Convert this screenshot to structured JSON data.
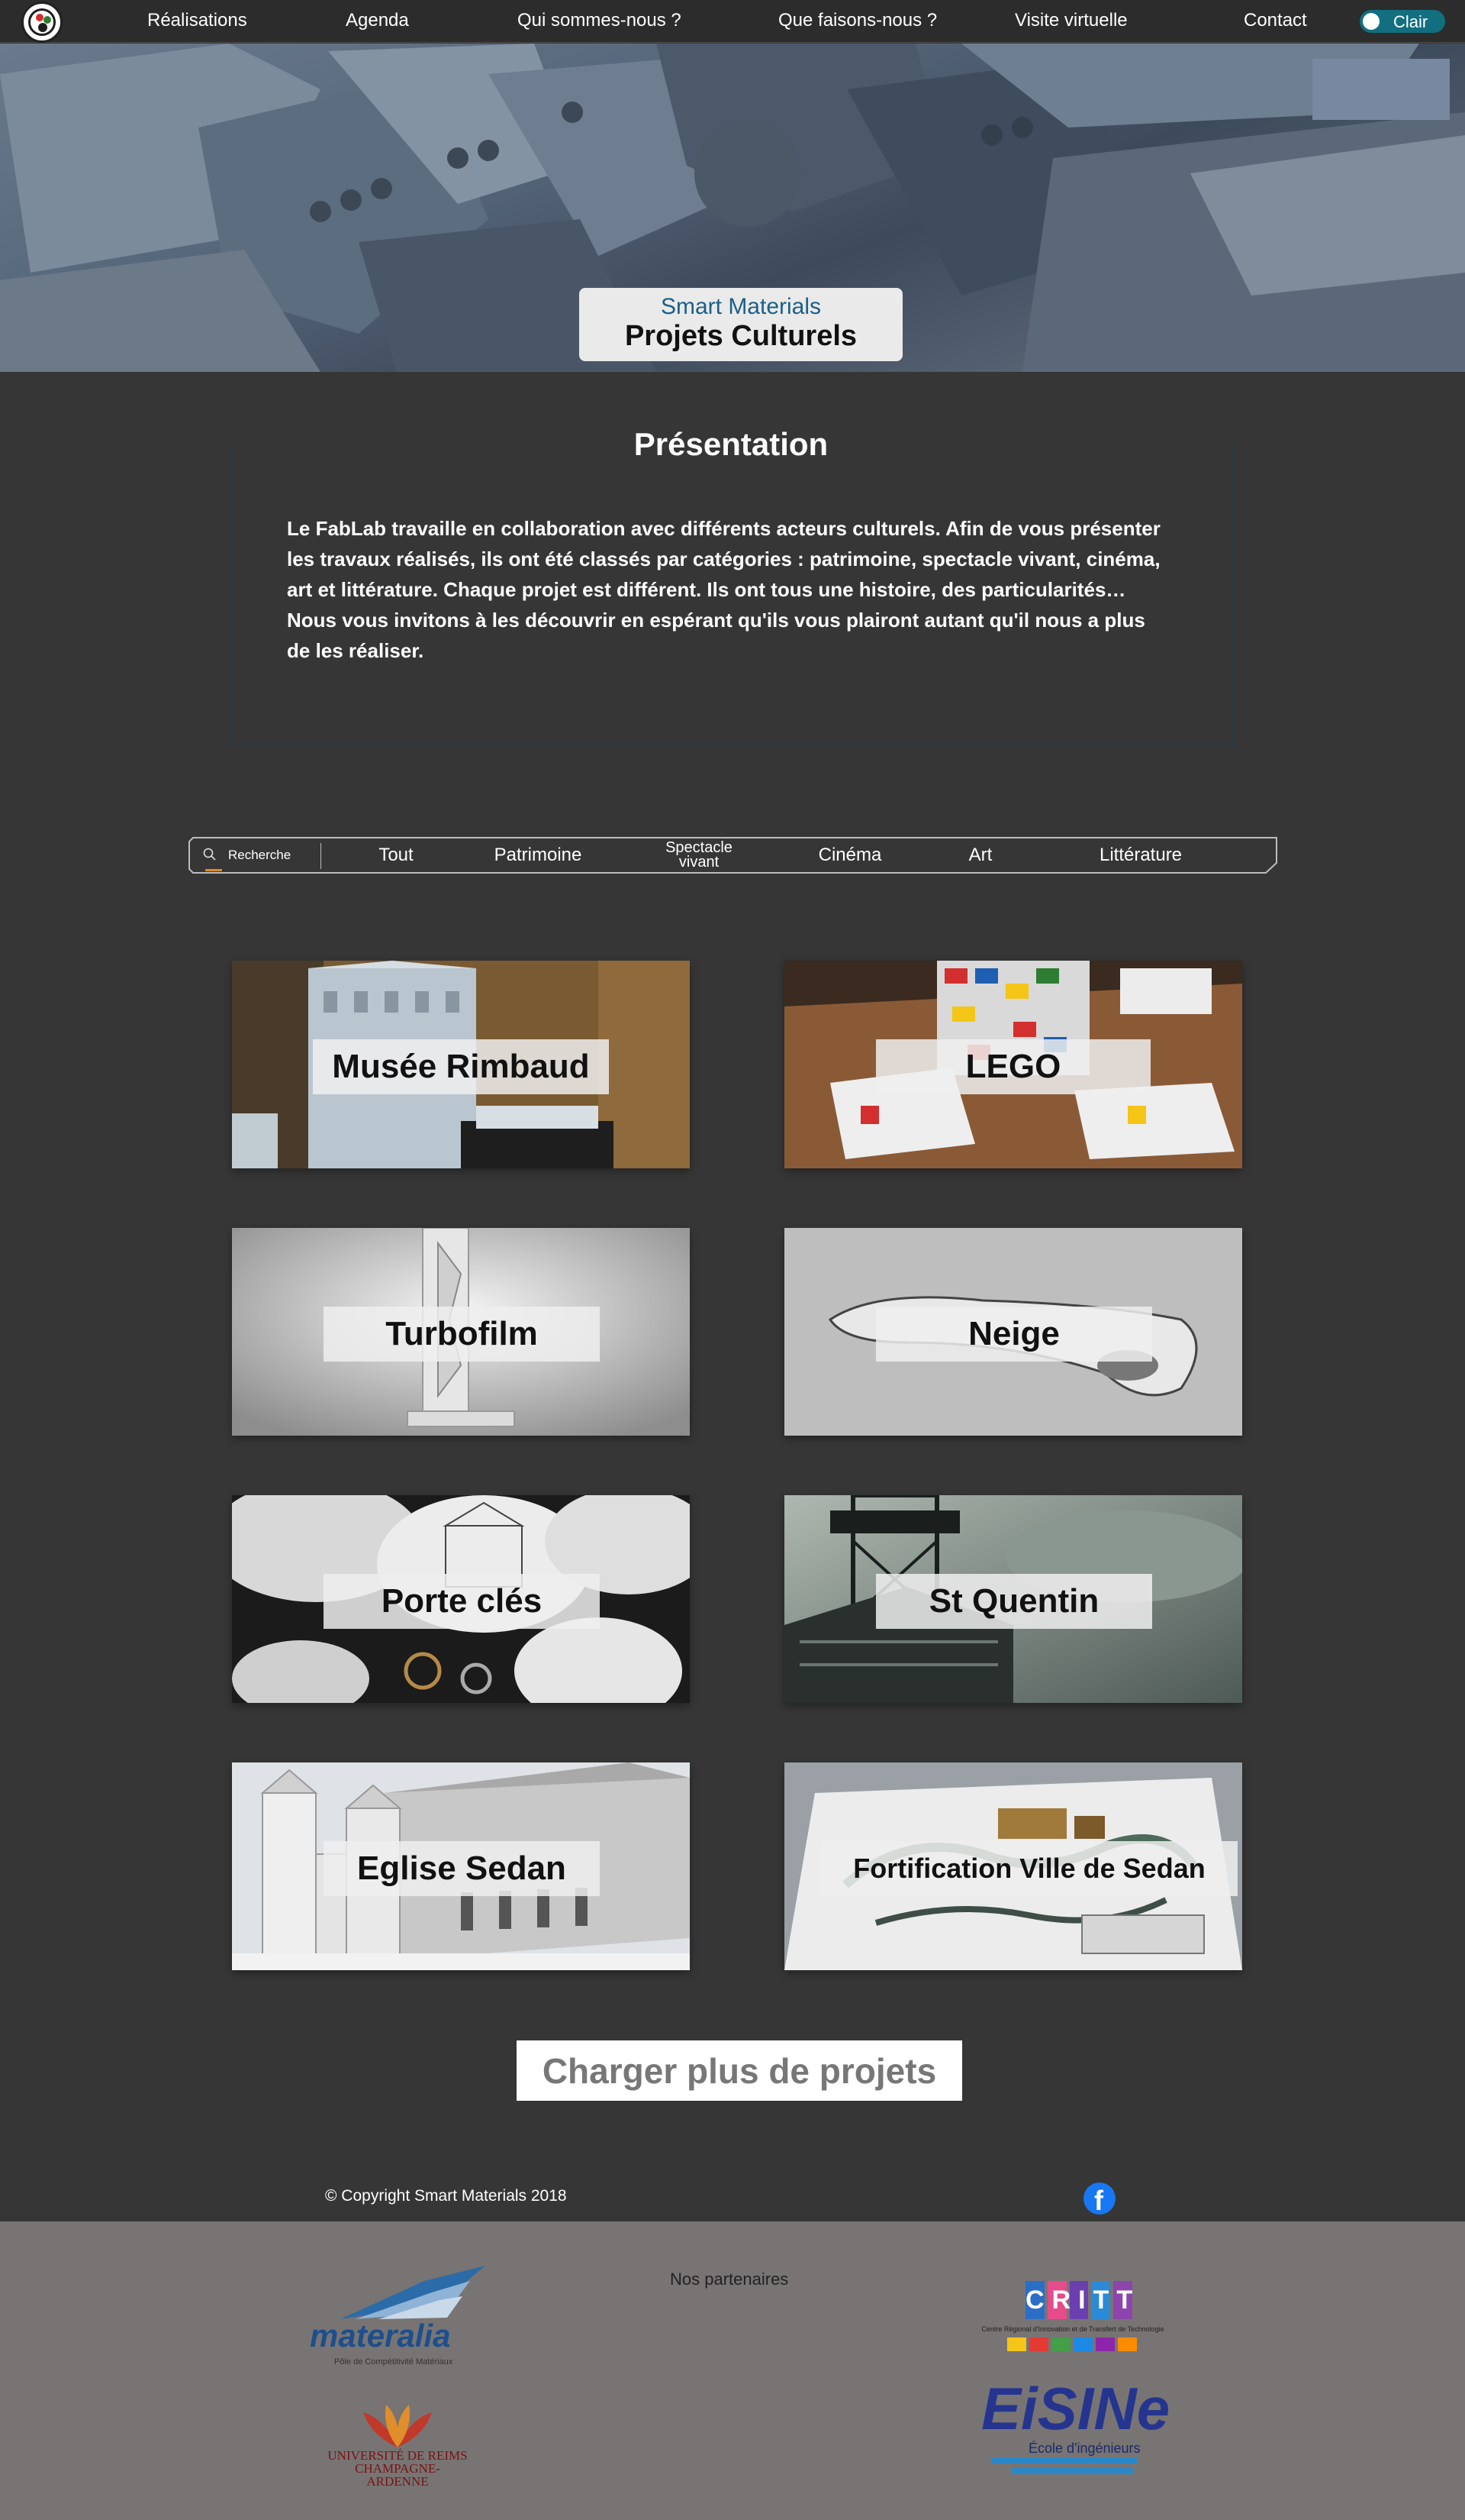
{
  "nav": {
    "items": [
      "Réalisations",
      "Agenda",
      "Qui sommes-nous ?",
      "Que faisons-nous ?",
      "Visite virtuelle",
      "Contact"
    ],
    "theme_toggle_label": "Clair"
  },
  "hero": {
    "subtitle": "Smart Materials",
    "title": "Projets Culturels"
  },
  "presentation": {
    "title": "Présentation",
    "text": "Le FabLab travaille en collaboration avec différents acteurs culturels. Afin de vous présenter les travaux réalisés, ils ont été classés par catégories : patrimoine, spectacle vivant, cinéma, art et littérature. Chaque projet est différent. Ils ont tous une histoire, des particularités… Nous vous invitons à les découvrir en espérant qu'ils vous plairont autant qu'il nous a plus de les réaliser."
  },
  "filter": {
    "search_placeholder": "Recherche",
    "tabs": [
      "Tout",
      "Patrimoine",
      "Spectacle vivant",
      "Cinéma",
      "Art",
      "Littérature"
    ],
    "active_tab": "Tout",
    "accent_color": "#e28a1f"
  },
  "projects": [
    {
      "title": "Musée Rimbaud"
    },
    {
      "title": "LEGO"
    },
    {
      "title": "Turbofilm"
    },
    {
      "title": "Neige"
    },
    {
      "title": "Porte clés"
    },
    {
      "title": "St Quentin"
    },
    {
      "title": "Eglise Sedan"
    },
    {
      "title": "Fortification Ville de Sedan"
    }
  ],
  "load_more_label": "Charger plus de projets",
  "footer": {
    "copyright": "© Copyright Smart Materials 2018",
    "social_icon": "facebook-icon",
    "partners_title": "Nos partenaires",
    "partners": [
      {
        "name": "materalia",
        "tagline": "Pôle de Compétitivité Matériaux"
      },
      {
        "name": "CRITT",
        "tagline": "Centre Régional d'Innovation et de Transfert de Technologie"
      },
      {
        "name": "UNIVERSITÉ DE REIMS CHAMPAGNE-ARDENNE"
      },
      {
        "name": "EiSINe",
        "tagline": "École d'ingénieurs"
      }
    ]
  },
  "colors": {
    "page_bg": "#363636",
    "nav_bg": "#2c2c2c",
    "toggle": "#116f80",
    "hero_subtitle": "#1c5f88",
    "partners_bg": "#787474"
  }
}
